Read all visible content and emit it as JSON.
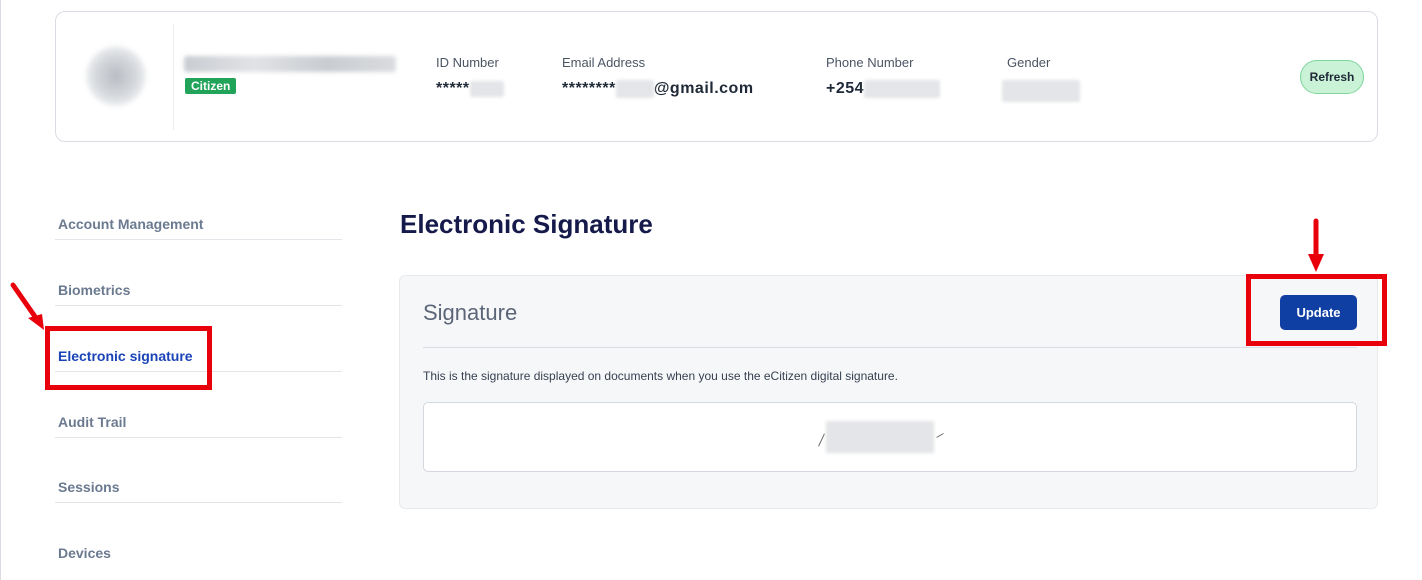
{
  "profile": {
    "badge": "Citizen",
    "fields": [
      {
        "label": "ID Number",
        "value": "*****"
      },
      {
        "label": "Email Address",
        "value_prefix": "********",
        "value_suffix": "@gmail.com"
      },
      {
        "label": "Phone Number",
        "value": "+254"
      },
      {
        "label": "Gender",
        "value": ""
      }
    ],
    "refresh_label": "Refresh"
  },
  "sidebar": {
    "items": [
      {
        "label": "Account Management"
      },
      {
        "label": "Biometrics"
      },
      {
        "label": "Electronic signature",
        "active": true
      },
      {
        "label": "Audit Trail"
      },
      {
        "label": "Sessions"
      },
      {
        "label": "Devices"
      }
    ]
  },
  "main": {
    "title": "Electronic Signature",
    "card": {
      "header": "Signature",
      "update_label": "Update",
      "description": "This is the signature displayed on documents when you use the eCitizen digital signature."
    }
  },
  "colors": {
    "accent": "#0f3fa3",
    "active_nav": "#1a44b8",
    "annotation": "#e8000b",
    "badge": "#21a35a",
    "refresh_bg": "#c9f2d6"
  }
}
